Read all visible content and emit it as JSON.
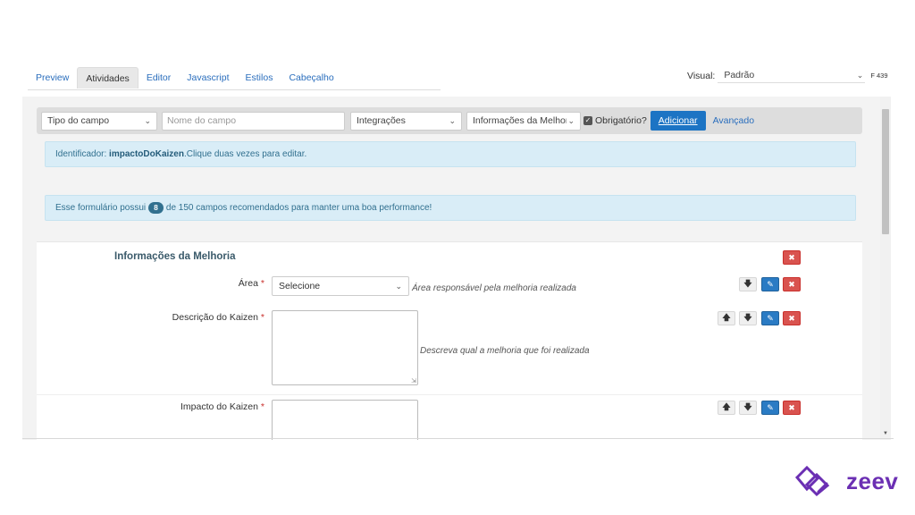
{
  "tabs": [
    "Preview",
    "Atividades",
    "Editor",
    "Javascript",
    "Estilos",
    "Cabeçalho"
  ],
  "active_tab": "Atividades",
  "visual": {
    "label": "Visual:",
    "value": "Padrão",
    "extra": "F 439"
  },
  "toolbar": {
    "field_type_placeholder": "Tipo do campo",
    "field_name_placeholder": "Nome do campo",
    "integrations": "Integrações",
    "section": "Informações da Melhoria",
    "required_label": "Obrigatório?",
    "required_checked": true,
    "add_button": "Adicionar",
    "advanced_link": "Avançado"
  },
  "identifier_alert": {
    "prefix": "Identificador:",
    "identifier": "impactoDoKaizen",
    "suffix": ".Clique duas vezes para editar."
  },
  "performance_alert": {
    "prefix": "Esse formulário possui",
    "count": "8",
    "suffix": "de 150 campos recomendados para manter uma boa performance!"
  },
  "form": {
    "section_title": "Informações da Melhoria",
    "fields": [
      {
        "label": "Área",
        "required": "*",
        "type": "select",
        "value": "Selecione",
        "help": "Área responsável pela melhoria realizada"
      },
      {
        "label": "Descrição do Kaizen",
        "required": "*",
        "type": "textarea",
        "value": "",
        "help": "Descreva qual a melhoria que foi realizada"
      },
      {
        "label": "Impacto do Kaizen",
        "required": "*",
        "type": "textarea",
        "value": "",
        "help": ""
      }
    ]
  },
  "brand": {
    "name": "zeev",
    "color": "#6b2fb3"
  },
  "icons": {
    "delete": "close-icon",
    "edit": "edit-icon",
    "move_up": "arrow-up-icon",
    "move_down": "arrow-down-icon"
  }
}
